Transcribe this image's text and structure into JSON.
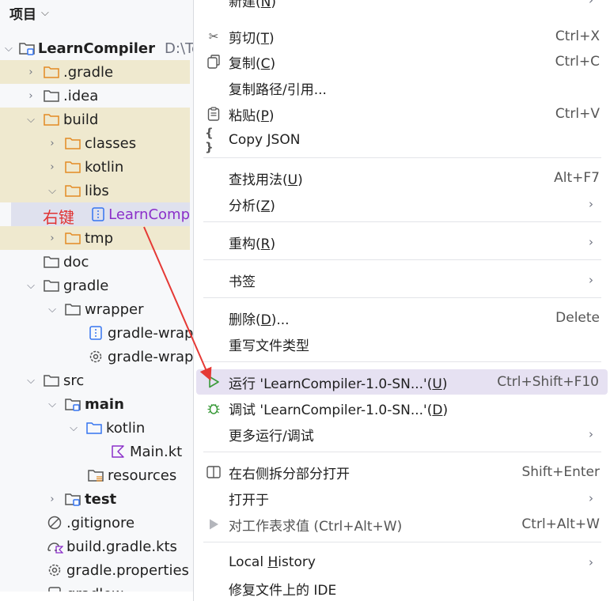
{
  "project": {
    "title": "项目",
    "items": [
      {
        "label": "LearnCompiler",
        "path": "D:\\Te"
      },
      {
        "label": ".gradle"
      },
      {
        "label": ".idea"
      },
      {
        "label": "build"
      },
      {
        "label": "classes"
      },
      {
        "label": "kotlin"
      },
      {
        "label": "libs"
      },
      {
        "label": "LearnComp"
      },
      {
        "label": "tmp"
      },
      {
        "label": "doc"
      },
      {
        "label": "gradle"
      },
      {
        "label": "wrapper"
      },
      {
        "label": "gradle-wrap"
      },
      {
        "label": "gradle-wrap"
      },
      {
        "label": "src"
      },
      {
        "label": "main"
      },
      {
        "label": "kotlin"
      },
      {
        "label": "Main.kt"
      },
      {
        "label": "resources"
      },
      {
        "label": "test"
      },
      {
        "label": ".gitignore"
      },
      {
        "label": "build.gradle.kts"
      },
      {
        "label": "gradle.properties"
      },
      {
        "label": "gradlew"
      }
    ]
  },
  "annotation": "右键",
  "menu": {
    "items": [
      {
        "label": "新建(N)",
        "pre": "新建(",
        "key": "N",
        "post": ")"
      },
      {
        "pre": "剪切(",
        "key": "T",
        "post": ")",
        "shortcut": "Ctrl+X"
      },
      {
        "pre": "复制(",
        "key": "C",
        "post": ")",
        "shortcut": "Ctrl+C"
      },
      {
        "label": "复制路径/引用..."
      },
      {
        "pre": "粘贴(",
        "key": "P",
        "post": ")",
        "shortcut": "Ctrl+V"
      },
      {
        "label": "Copy JSON"
      },
      {
        "pre": "查找用法(",
        "key": "U",
        "post": ")",
        "shortcut": "Alt+F7"
      },
      {
        "pre": "分析(",
        "key": "Z",
        "post": ")"
      },
      {
        "pre": "重构(",
        "key": "R",
        "post": ")"
      },
      {
        "label": "书签"
      },
      {
        "pre": "删除(",
        "key": "D",
        "post": ")...",
        "shortcut": "Delete"
      },
      {
        "label": "重写文件类型"
      },
      {
        "pre": "运行 'LearnCompiler-1.0-SN...'(",
        "key": "U",
        "post": ")",
        "shortcut": "Ctrl+Shift+F10"
      },
      {
        "pre": "调试 'LearnCompiler-1.0-SN...'(",
        "key": "D",
        "post": ")"
      },
      {
        "label": "更多运行/调试"
      },
      {
        "label": "在右侧拆分部分打开",
        "shortcut": "Shift+Enter"
      },
      {
        "label": "打开于"
      },
      {
        "label": "对工作表求值 (Ctrl+Alt+W)",
        "shortcut": "Ctrl+Alt+W"
      },
      {
        "pre": "Local ",
        "key": "H",
        "post": "istory"
      },
      {
        "label": "修复文件上的 IDE"
      }
    ]
  }
}
